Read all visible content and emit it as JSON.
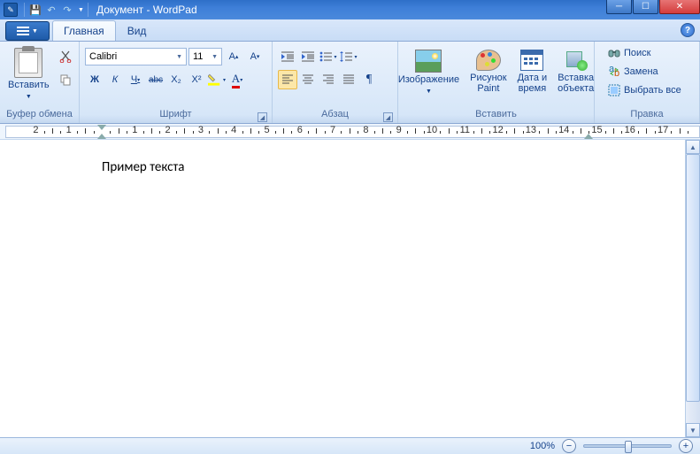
{
  "title": "Документ - WordPad",
  "tabs": {
    "home": "Главная",
    "view": "Вид"
  },
  "groups": {
    "clipboard": "Буфер обмена",
    "font": "Шрифт",
    "paragraph": "Абзац",
    "insert": "Вставить",
    "editing": "Правка"
  },
  "clipboard": {
    "paste": "Вставить"
  },
  "font": {
    "name": "Calibri",
    "size": "11",
    "grow": "A",
    "shrink": "A",
    "bold": "Ж",
    "italic": "К",
    "underline": "Ч",
    "strike": "abc",
    "sub": "X₂",
    "sup": "X²",
    "fontcolor": "A"
  },
  "insert": {
    "picture": "Изображение",
    "paint": "Рисунок\nPaint",
    "datetime": "Дата и\nвремя",
    "object": "Вставка\nобъекта"
  },
  "editing": {
    "find": "Поиск",
    "replace": "Замена",
    "selectall": "Выбрать все"
  },
  "ruler": {
    "numbers": [
      "2",
      "1",
      "",
      "1",
      "2",
      "3",
      "4",
      "5",
      "6",
      "7",
      "8",
      "9",
      "10",
      "11",
      "12",
      "13",
      "14",
      "15",
      "16",
      "17"
    ]
  },
  "document": {
    "text": "Пример текста"
  },
  "status": {
    "zoom": "100%",
    "minus": "−",
    "plus": "+"
  }
}
